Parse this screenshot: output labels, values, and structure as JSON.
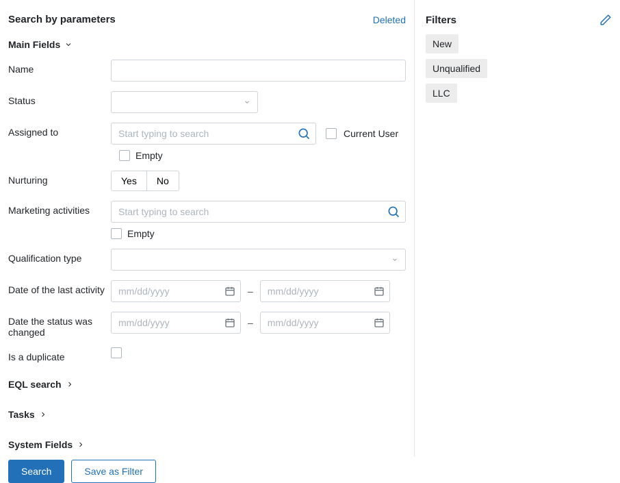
{
  "header": {
    "title": "Search by parameters",
    "deleted_link": "Deleted"
  },
  "sections": {
    "main_fields": "Main Fields",
    "eql_search": "EQL search",
    "tasks": "Tasks",
    "system_fields": "System Fields"
  },
  "fields": {
    "name_label": "Name",
    "status_label": "Status",
    "assigned_to_label": "Assigned to",
    "assigned_placeholder": "Start typing to search",
    "current_user_label": "Current User",
    "empty_label": "Empty",
    "nurturing_label": "Nurturing",
    "nurturing_yes": "Yes",
    "nurturing_no": "No",
    "marketing_activities_label": "Marketing activities",
    "marketing_placeholder": "Start typing to search",
    "qualification_type_label": "Qualification type",
    "date_last_activity_label": "Date of the last activity",
    "date_status_changed_label": "Date the status was changed",
    "date_placeholder": "mm/dd/yyyy",
    "is_duplicate_label": "Is a duplicate"
  },
  "actions": {
    "search": "Search",
    "save_as_filter": "Save as Filter"
  },
  "filters": {
    "title": "Filters",
    "items": [
      "New",
      "Unqualified",
      "LLC"
    ]
  }
}
